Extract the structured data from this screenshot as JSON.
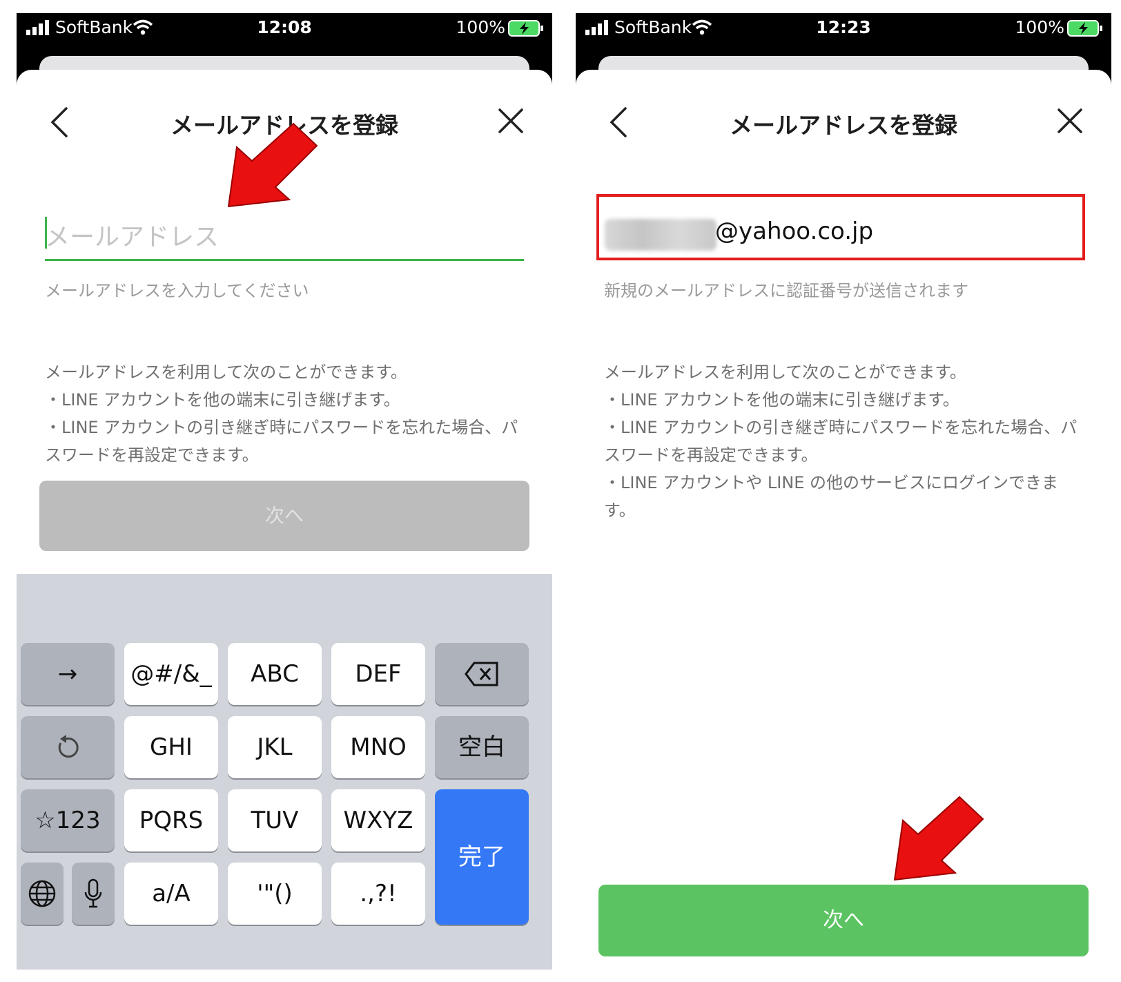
{
  "left_screen": {
    "status": {
      "carrier": "SoftBank",
      "time": "12:08",
      "battery": "100%"
    },
    "title": "メールアドレスを登録",
    "email_placeholder": "メールアドレス",
    "hint": "メールアドレスを入力してください",
    "description": [
      "メールアドレスを利用して次のことができます。",
      "・LINE アカウントを他の端末に引き継げます。",
      "・LINE アカウントの引き継ぎ時にパスワードを忘れた場合、パスワードを再設定できます。"
    ],
    "next_label": "次へ",
    "keyboard": {
      "row1": [
        "→",
        "@#/&_",
        "ABC",
        "DEF"
      ],
      "row2": [
        "GHI",
        "JKL",
        "MNO",
        "空白"
      ],
      "row3": [
        "☆123",
        "PQRS",
        "TUV",
        "WXYZ"
      ],
      "row4": [
        "a/A",
        "'\"()",
        ".,?!"
      ],
      "done": "完了"
    }
  },
  "right_screen": {
    "status": {
      "carrier": "SoftBank",
      "time": "12:23",
      "battery": "100%"
    },
    "title": "メールアドレスを登録",
    "email_value": "@yahoo.co.jp",
    "hint": "新規のメールアドレスに認証番号が送信されます",
    "description": [
      "メールアドレスを利用して次のことができます。",
      "・LINE アカウントを他の端末に引き継げます。",
      "・LINE アカウントの引き継ぎ時にパスワードを忘れた場合、パスワードを再設定できます。",
      "・LINE アカウントや LINE の他のサービスにログインできます。"
    ],
    "next_label": "次へ"
  },
  "colors": {
    "accent_green": "#5cc362",
    "highlight_red": "#e41d1d",
    "keyboard_blue": "#3478f6"
  }
}
